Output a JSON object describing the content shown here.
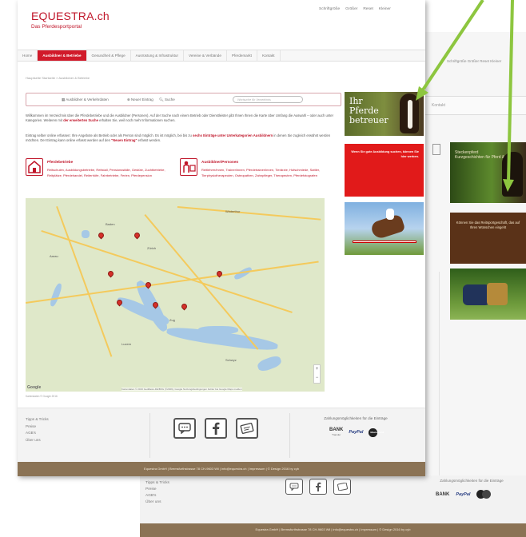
{
  "back": {
    "toplinks": "Schriftgröße  Größer  Reset  Kleiner",
    "ad_stecken_title": "Steckenpferd",
    "ad_stecken_sub": "Kurzgeschichten für Pferd & Reiter",
    "ad_brown_text": "Können Sie das Reitsportgeschäft, das auf Ihren Wünschen eingeht",
    "footer_links": [
      "Tipps & Tricks",
      "Preise",
      "AGB's",
      "Über uns"
    ],
    "pay_title": "Zahlungsmöglichkeiten für die Einträge",
    "bar_text": "Equestra GmbH | Bremsfurthstrasse 78 CH-9603 Wil | info@equestra.ch | Impressum | © Design 2016 by cyb"
  },
  "site": {
    "logo_main": "EQUESTRA.ch",
    "logo_sub": "Das Pferdesportportal",
    "toplinks": [
      "Schriftgröße",
      "Größer",
      "Reset",
      "Kleiner"
    ],
    "nav": [
      {
        "label": "Home",
        "active": false
      },
      {
        "label": "Ausbildner & Betriebe",
        "active": true
      },
      {
        "label": "Gesundheit & Pflege",
        "active": false
      },
      {
        "label": "Ausrüstung & Infrastruktur",
        "active": false
      },
      {
        "label": "Vereine & Verbände",
        "active": false
      },
      {
        "label": "Pferdemarkt",
        "active": false
      },
      {
        "label": "Kontakt",
        "active": false
      }
    ],
    "breadcrumb": "Hauptseite  Startseite  »  Ausbildner & Betriebe"
  },
  "toolbar": {
    "item1": "Ausbildner & Verkehrdaten",
    "item2": "Neuer Eintrag",
    "item3": "Suche",
    "search_placeholder": "Wortsuche für Verzeichnis"
  },
  "intro": {
    "p1_a": "Willkommen im Verzeichnis über die Pferdebetriebe und die Ausbildner (Personen). Auf der Suche nach einem Betrieb oder Dienstleister gibt Ihnen Ihnen die Karte über Umfang die Auswahl – oder auch unter Kategorien. Weiteren mit",
    "p1_b": "der erweiterten Suche",
    "p1_c": "erhalten Sie, weil noch mehr Informationen suchen.",
    "p2_a": "Eintrag selber online erfassen: Ihre Angebote als Betrieb oder als Person sind möglich. Es ist möglich, bei bis zu",
    "p2_b": "sechs Einträge unter Unterkategorien Ausbildnern",
    "p2_c": "in denen Sie zugleich erwähnt werden möchten. Der Eintrag kann online erfasst werden auf den",
    "p2_d": "\"Neuen Eintrag\"",
    "p2_e": "erfasst werden."
  },
  "categories": {
    "left_title": "Pferdebetriebe",
    "left_links": "Reitschulen, Ausbildungsbetriebe, Reitstall, Pensionsställe, Gestüte, Zuchtbetriebe, Reitplätze, Pferdehandel, Reiterhöfe, Fahrbetriebe, Ferien, Pferdepension",
    "right_title": "Ausbildner/Personen",
    "right_links": "Reitlehrer/innen, Trainer/innen, Pferdetrainer/innen, Tierärzte, Hufschmiede, Sattler, Tierphysiotherapeuten, Osteopathen, Zahnpfleger, Therapeuten, Pferdefotografen"
  },
  "map": {
    "cities": [
      "Winterthur",
      "Zürich",
      "Baden",
      "Zug",
      "Luzern",
      "Schwyz",
      "Aarau"
    ],
    "attribution": "Kartendaten © 2016 GeoBasis-DE/BKG (©2009), Google  Nutzungsbedingungen  Fehler bei Google Maps melden",
    "google": "Google",
    "zoom_in": "+",
    "zoom_out": "−",
    "note": "Kartendaten © Google 2016"
  },
  "ads": {
    "pferde_line1": "Ihr",
    "pferde_line2": "Pferde",
    "pferde_line3": "betreuer",
    "red_text": "Wenn Sie gute Ausbildung suchen, können Sie hier werben."
  },
  "footer": {
    "links": [
      "Tipps & Tricks",
      "Preise",
      "AGB's",
      "Über uns"
    ],
    "pay_title": "Zahlungsmöglichkeiten für die Einträge",
    "bank_label": "BANK",
    "bank_sub": "Transfer",
    "paypal": "PayPal",
    "mastercard": "MasterCard",
    "bar_text": "Equestra GmbH | Bremsfurthstrasse 78 CH-9603 Wil | info@equestra.ch | Impressum | © Design 2016 by cyb"
  },
  "colors": {
    "brand_red": "#c0162a",
    "nav_active": "#d11a2a",
    "footer_bar": "#8b7355",
    "arrow_green": "#8dc63f"
  }
}
